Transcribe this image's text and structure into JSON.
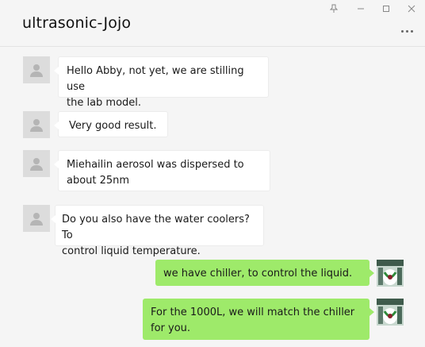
{
  "header": {
    "title": "ultrasonic-Jojo",
    "controls": [
      "pin-icon",
      "minimize-icon",
      "maximize-icon",
      "close-icon"
    ],
    "more_icon": "more-dots-icon"
  },
  "colors": {
    "incoming_bubble": "#ffffff",
    "outgoing_bubble": "#9eea6a",
    "background": "#f5f5f5"
  },
  "messages": [
    {
      "from": "other",
      "text": "Hello Abby, not yet, we are stilling use\nthe lab model."
    },
    {
      "from": "other",
      "text": "Very good result."
    },
    {
      "from": "other",
      "text": "Miehailin aerosol was dispersed to\nabout 25nm"
    },
    {
      "from": "other",
      "text": "Do you also have the water coolers? To\ncontrol liquid temperature."
    },
    {
      "from": "me",
      "text": "we have chiller, to control the liquid."
    },
    {
      "from": "me",
      "text": "For the 1000L, we will match the chiller\nfor you."
    }
  ]
}
